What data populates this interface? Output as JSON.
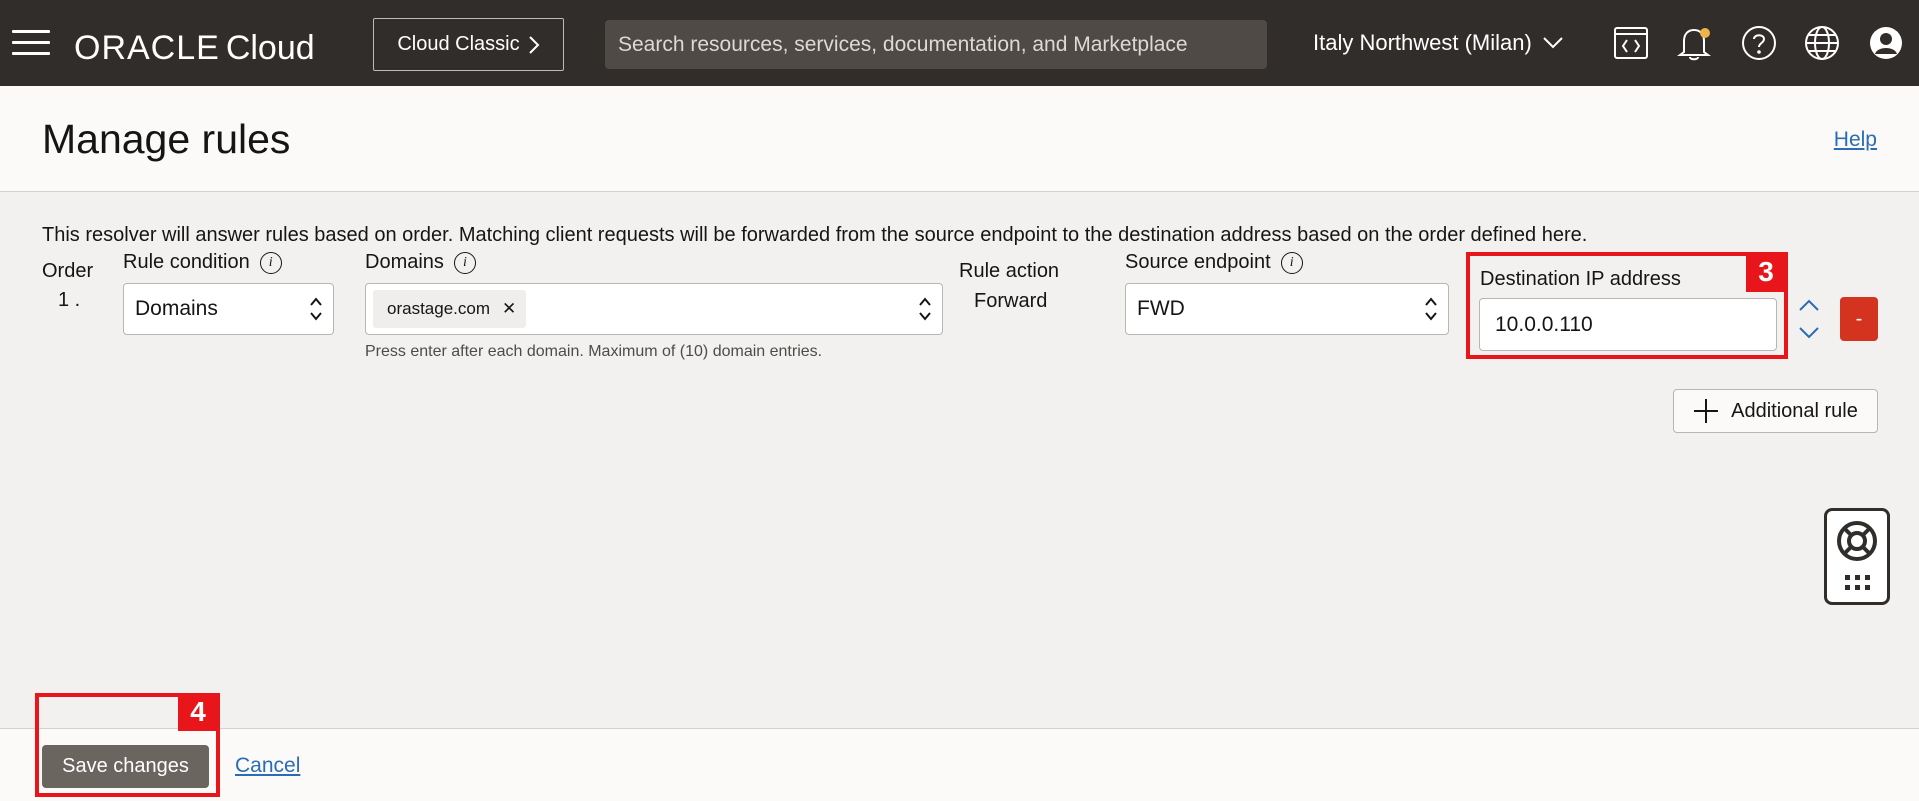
{
  "topbar": {
    "logo_brand": "ORACLE",
    "logo_product": "Cloud",
    "classic_button": "Cloud Classic",
    "search_placeholder": "Search resources, services, documentation, and Marketplace",
    "region": "Italy Northwest (Milan)",
    "icons": [
      "code-editor-icon",
      "bell-icon",
      "help-icon",
      "globe-icon",
      "user-icon"
    ]
  },
  "header": {
    "title": "Manage rules",
    "help_link": "Help"
  },
  "form": {
    "intro": "This resolver will answer rules based on order. Matching client requests will be forwarded from the source endpoint to the destination address based on the order defined here.",
    "order_label": "Order",
    "order_value": "1 .",
    "rule_condition_label": "Rule condition",
    "rule_condition_value": "Domains",
    "domains_label": "Domains",
    "domain_chip": "orastage.com",
    "domains_hint": "Press enter after each domain. Maximum of (10) domain entries.",
    "rule_action_label": "Rule action",
    "rule_action_value": "Forward",
    "source_endpoint_label": "Source endpoint",
    "source_endpoint_value": "FWD",
    "destination_label": "Destination IP address",
    "destination_value": "10.0.0.110",
    "remove_label": "-",
    "additional_rule": "Additional rule"
  },
  "annotations": {
    "step3": "3",
    "step4": "4",
    "color": "#e8151b"
  },
  "footer": {
    "save": "Save changes",
    "cancel": "Cancel"
  },
  "colors": {
    "topbar": "#312d2a",
    "link": "#2b6db5",
    "danger": "#d4331f",
    "save_button": "#6b6560"
  }
}
